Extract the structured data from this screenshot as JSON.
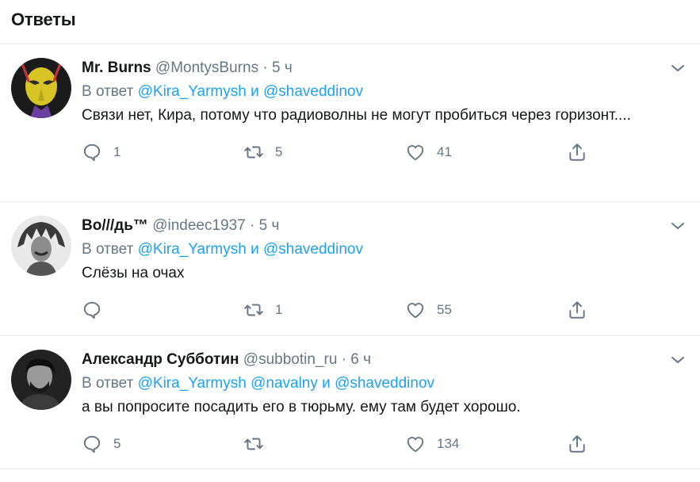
{
  "header": {
    "title": "Ответы"
  },
  "tweets": [
    {
      "name": "Mr. Burns",
      "handle": "@MontysBurns",
      "time": "5 ч",
      "reply_prefix": "В ответ",
      "mentions": [
        "@Kira_Yarmysh",
        "и",
        "@shaveddinov"
      ],
      "text": "Связи нет, Кира, потому что радиоволны не могут пробиться через горизонт....",
      "replies": "1",
      "retweets": "5",
      "likes": "41"
    },
    {
      "name": "Во///дь™",
      "handle": "@indeec1937",
      "time": "5 ч",
      "reply_prefix": "В ответ",
      "mentions": [
        "@Kira_Yarmysh",
        "и",
        "@shaveddinov"
      ],
      "text": "Слёзы на очах",
      "replies": "",
      "retweets": "1",
      "likes": "55"
    },
    {
      "name": "Александр Субботин",
      "handle": "@subbotin_ru",
      "time": "6 ч",
      "reply_prefix": "В ответ",
      "mentions": [
        "@Kira_Yarmysh",
        "@navalny",
        "и",
        "@shaveddinov"
      ],
      "text": "а вы попросите посадить его в тюрьму. ему там будет хорошо.",
      "replies": "5",
      "retweets": "",
      "likes": "134"
    }
  ],
  "icons": {
    "reply": "reply-icon",
    "retweet": "retweet-icon",
    "like": "heart-icon",
    "share": "share-icon",
    "more": "chevron-down-icon"
  },
  "colors": {
    "link": "#1da1f2",
    "secondary": "#657786",
    "divider": "#e6ecf0"
  }
}
